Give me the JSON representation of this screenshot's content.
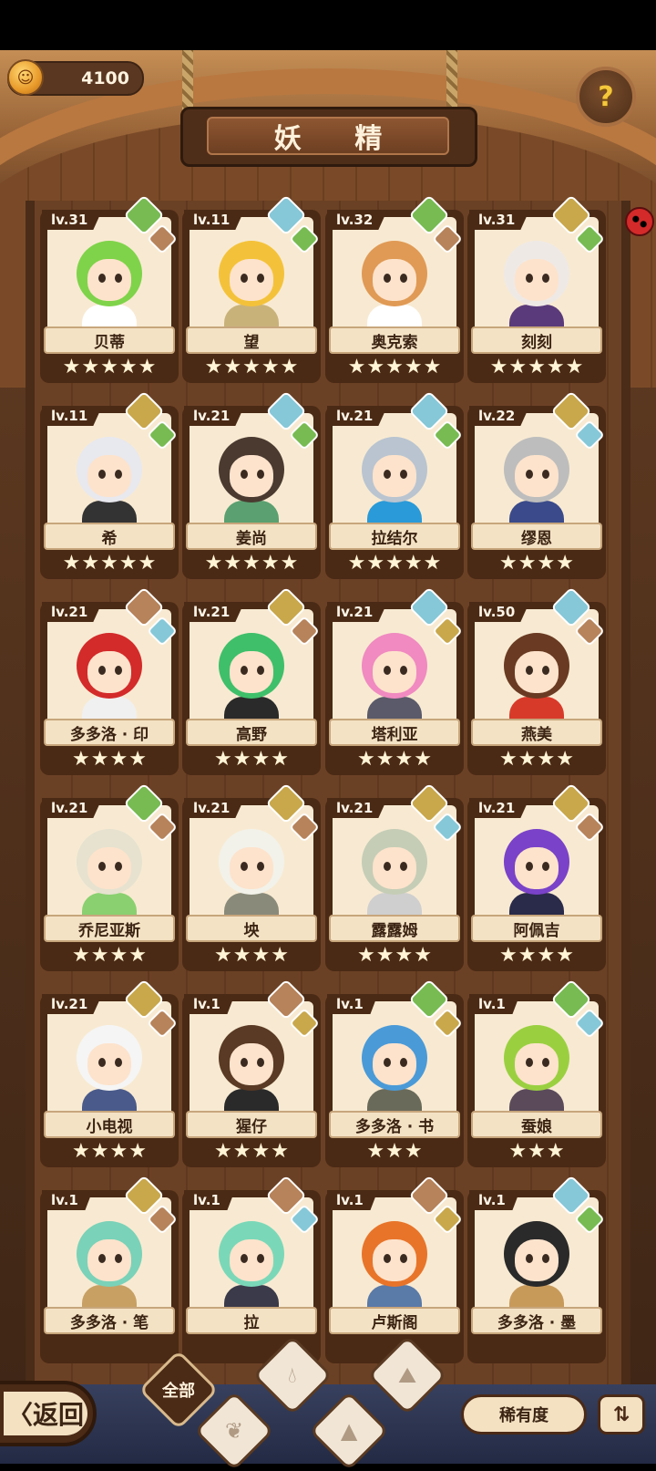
{
  "coin": {
    "value": "4100"
  },
  "title": "妖 精",
  "cards": [
    {
      "level": "lv.31",
      "name": "贝蒂",
      "stars": 5,
      "hair": "#7fd34a",
      "outfit": "#ffffff",
      "el1": "e-leaf",
      "el2": "e-mount"
    },
    {
      "level": "lv.11",
      "name": "望",
      "stars": 5,
      "hair": "#f4c23a",
      "outfit": "#c9b27a",
      "el1": "e-water",
      "el2": "e-leaf"
    },
    {
      "level": "lv.32",
      "name": "奥克索",
      "stars": 5,
      "hair": "#e09a55",
      "outfit": "#ffffff",
      "el1": "e-leaf",
      "el2": "e-mount"
    },
    {
      "level": "lv.31",
      "name": "刻刻",
      "stars": 5,
      "hair": "#efe9e6",
      "outfit": "#5a3a7a",
      "el1": "e-earth",
      "el2": "e-leaf"
    },
    {
      "level": "lv.11",
      "name": "希",
      "stars": 5,
      "hair": "#e8e8ef",
      "outfit": "#333333",
      "el1": "e-earth",
      "el2": "e-leaf"
    },
    {
      "level": "lv.21",
      "name": "姜尚",
      "stars": 5,
      "hair": "#4a3a30",
      "outfit": "#5aa070",
      "el1": "e-water",
      "el2": "e-leaf"
    },
    {
      "level": "lv.21",
      "name": "拉结尔",
      "stars": 5,
      "hair": "#b9c4d0",
      "outfit": "#2a9ad8",
      "el1": "e-water",
      "el2": "e-leaf"
    },
    {
      "level": "lv.22",
      "name": "缪恩",
      "stars": 4,
      "hair": "#bdbdbd",
      "outfit": "#3a4a8a",
      "el1": "e-earth",
      "el2": "e-water"
    },
    {
      "level": "lv.21",
      "name": "多多洛 · 印",
      "stars": 4,
      "hair": "#d32a2a",
      "outfit": "#f0f0f0",
      "el1": "e-mount",
      "el2": "e-water"
    },
    {
      "level": "lv.21",
      "name": "高野",
      "stars": 4,
      "hair": "#3fbf6a",
      "outfit": "#2a2a2a",
      "el1": "e-earth",
      "el2": "e-mount"
    },
    {
      "level": "lv.21",
      "name": "塔利亚",
      "stars": 4,
      "hair": "#f08ac0",
      "outfit": "#5a5a6a",
      "el1": "e-water",
      "el2": "e-earth"
    },
    {
      "level": "lv.50",
      "name": "燕美",
      "stars": 4,
      "hair": "#6a3a22",
      "outfit": "#d83a2a",
      "el1": "e-water",
      "el2": "e-mount"
    },
    {
      "level": "lv.21",
      "name": "乔尼亚斯",
      "stars": 4,
      "hair": "#e6e2cf",
      "outfit": "#8ad070",
      "el1": "e-leaf",
      "el2": "e-mount"
    },
    {
      "level": "lv.21",
      "name": "坱",
      "stars": 4,
      "hair": "#f2f2ea",
      "outfit": "#8a8a7a",
      "el1": "e-earth",
      "el2": "e-mount"
    },
    {
      "level": "lv.21",
      "name": "露露姆",
      "stars": 4,
      "hair": "#c5cdb6",
      "outfit": "#cfcfcf",
      "el1": "e-earth",
      "el2": "e-water"
    },
    {
      "level": "lv.21",
      "name": "阿佩吉",
      "stars": 4,
      "hair": "#7a42c8",
      "outfit": "#2a2a4a",
      "el1": "e-earth",
      "el2": "e-mount"
    },
    {
      "level": "lv.21",
      "name": "小电视",
      "stars": 4,
      "hair": "#f5f5f5",
      "outfit": "#4a5a8a",
      "el1": "e-earth",
      "el2": "e-mount"
    },
    {
      "level": "lv.1",
      "name": "猩仔",
      "stars": 4,
      "hair": "#5a3a24",
      "outfit": "#2a2a2a",
      "el1": "e-mount",
      "el2": "e-earth"
    },
    {
      "level": "lv.1",
      "name": "多多洛 · 书",
      "stars": 3,
      "hair": "#4a9ad8",
      "outfit": "#6a6a5a",
      "el1": "e-leaf",
      "el2": "e-earth"
    },
    {
      "level": "lv.1",
      "name": "蚕娘",
      "stars": 3,
      "hair": "#9ad040",
      "outfit": "#5a4a5a",
      "el1": "e-leaf",
      "el2": "e-water"
    },
    {
      "level": "lv.1",
      "name": "多多洛 · 笔",
      "stars": 0,
      "hair": "#7ad2b8",
      "outfit": "#c8a064",
      "el1": "e-earth",
      "el2": "e-mount"
    },
    {
      "level": "lv.1",
      "name": "拉",
      "stars": 0,
      "hair": "#7ad8b8",
      "outfit": "#3a3a4a",
      "el1": "e-mount",
      "el2": "e-water"
    },
    {
      "level": "lv.1",
      "name": "卢斯阁",
      "stars": 0,
      "hair": "#e8742a",
      "outfit": "#5a7aa8",
      "el1": "e-mount",
      "el2": "e-earth"
    },
    {
      "level": "lv.1",
      "name": "多多洛 · 墨",
      "stars": 0,
      "hair": "#2a2a2a",
      "outfit": "#c89a5a",
      "el1": "e-water",
      "el2": "e-leaf"
    }
  ],
  "bottom": {
    "back_label": "〈返回",
    "filter_all": "全部",
    "filter_icons": [
      "water-drop-icon",
      "sprout-icon",
      "mountain-icon",
      "hill-icon"
    ],
    "rarity_label": "稀有度",
    "sort_icon": "sort-icon"
  }
}
